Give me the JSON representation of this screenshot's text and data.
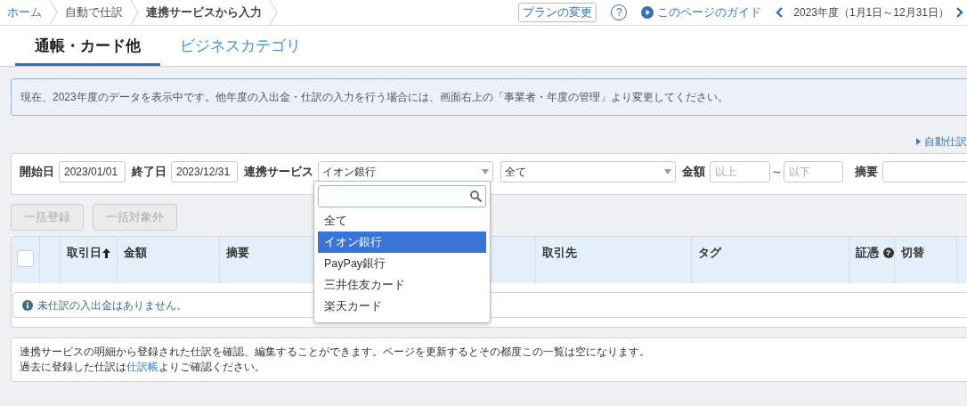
{
  "breadcrumbs": [
    {
      "label": "ホーム",
      "kind": "link"
    },
    {
      "label": "自動で仕訳",
      "kind": "link"
    },
    {
      "label": "連携サービスから入力",
      "kind": "current"
    }
  ],
  "header": {
    "plan_button": "プランの変更",
    "help_icon": "?",
    "guide_link": "このページのガイド",
    "fiscal_year": "2023年度（1月1日～12月31日）"
  },
  "tabs": [
    {
      "label": "通帳・カード他",
      "selected": true
    },
    {
      "label": "ビジネスカテゴリ",
      "selected": false
    }
  ],
  "notice": "現在、2023年度のデータを表示中です。他年度の入出金・仕訳の入力を行う場合には、画面右上の「事業者・年度の管理」より変更してください。",
  "auto_link": "自動仕訳",
  "filters": {
    "start_label": "開始日",
    "start_value": "2023/01/01",
    "end_label": "終了日",
    "end_value": "2023/12/31",
    "service_label": "連携サービス",
    "service_value": "イオン銀行",
    "account_value": "全て",
    "amount_label": "金額",
    "min_placeholder": "以上",
    "range_sep": "～",
    "max_placeholder": "以下",
    "memo_label": "摘要"
  },
  "bulk_buttons": [
    {
      "label": "一括登録",
      "disabled": true
    },
    {
      "label": "一括対象外",
      "disabled": true
    }
  ],
  "table": {
    "columns": [
      {
        "kind": "checkbox",
        "checked": false
      },
      {
        "kind": "blank"
      },
      {
        "kind": "sort",
        "label": "取引日"
      },
      {
        "kind": "text",
        "label": "金額"
      },
      {
        "kind": "text",
        "label": "摘要"
      },
      {
        "kind": "text",
        "label": "取引先"
      },
      {
        "kind": "text",
        "label": "タグ"
      },
      {
        "kind": "help",
        "label": "証憑",
        "help_mark": "?"
      },
      {
        "kind": "text",
        "label": "切替"
      },
      {
        "kind": "blank"
      }
    ],
    "empty_message": "未仕訳の入出金はありません。"
  },
  "footer_note": {
    "line_1": "連携サービスの明細から登録された仕訳を確認、編集することができます。ページを更新するとその都度この一覧は空になります。",
    "line_2_before": "過去に登録した仕訳は",
    "line_2_link": "仕訳帳",
    "line_2_after": "よりご確認ください。"
  },
  "dropdown": {
    "options": [
      {
        "label": "全て",
        "selected": false
      },
      {
        "label": "イオン銀行",
        "selected": true
      },
      {
        "label": "PayPay銀行",
        "selected": false
      },
      {
        "label": "三井住友カード",
        "selected": false
      },
      {
        "label": "楽天カード",
        "selected": false
      }
    ]
  }
}
